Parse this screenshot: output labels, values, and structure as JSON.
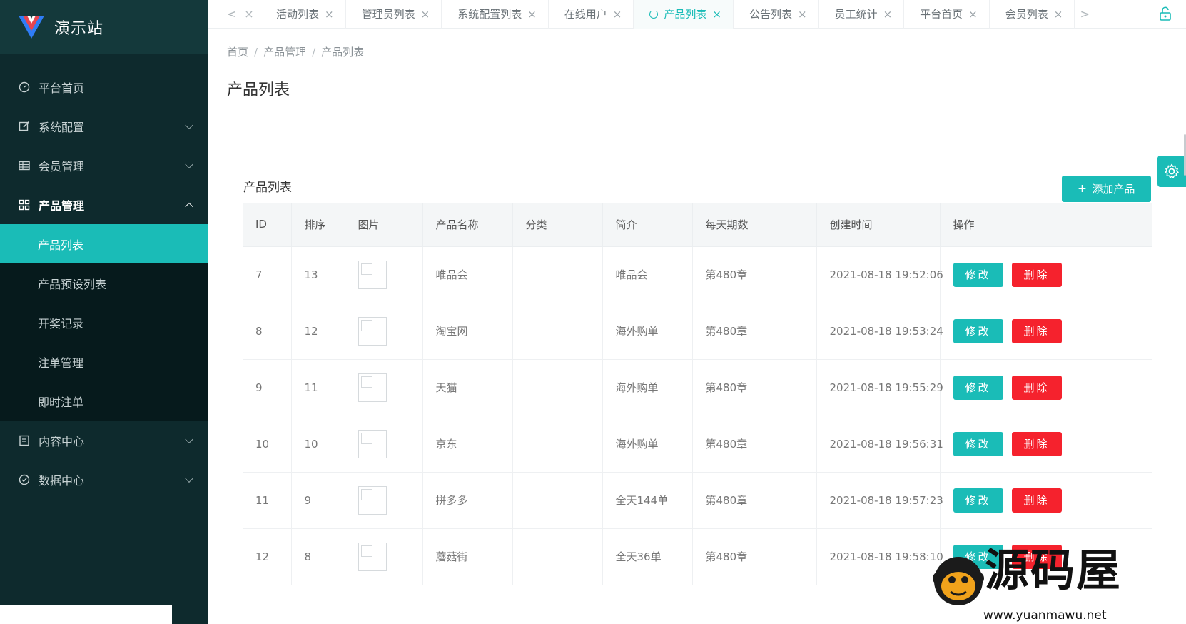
{
  "app": {
    "name": "演示站"
  },
  "sidebar": {
    "items": [
      {
        "label": "平台首页",
        "icon": "dashboard-icon",
        "has_arrow": false
      },
      {
        "label": "系统配置",
        "icon": "edit-icon",
        "has_arrow": true
      },
      {
        "label": "会员管理",
        "icon": "table-icon",
        "has_arrow": true
      },
      {
        "label": "产品管理",
        "icon": "grid-icon",
        "has_arrow": true,
        "open": true
      }
    ],
    "submenu": [
      {
        "label": "产品列表",
        "active": true
      },
      {
        "label": "产品预设列表"
      },
      {
        "label": "开奖记录"
      },
      {
        "label": "注单管理"
      },
      {
        "label": "即时注单"
      }
    ],
    "items_after": [
      {
        "label": "内容中心",
        "icon": "document-icon"
      },
      {
        "label": "数据中心",
        "icon": "check-circle-icon"
      }
    ]
  },
  "tabs": {
    "prev": "<",
    "next": ">",
    "first_close": "×",
    "items": [
      {
        "label": "活动列表"
      },
      {
        "label": "管理员列表"
      },
      {
        "label": "系统配置列表"
      },
      {
        "label": "在线用户"
      },
      {
        "label": "产品列表",
        "active": true
      },
      {
        "label": "公告列表"
      },
      {
        "label": "员工统计"
      },
      {
        "label": "平台首页"
      },
      {
        "label": "会员列表"
      }
    ],
    "close": "×"
  },
  "breadcrumb": {
    "home": "首页",
    "section": "产品管理",
    "current": "产品列表",
    "sep": "/"
  },
  "page": {
    "title": "产品列表"
  },
  "card": {
    "title": "产品列表",
    "add_button": "添加产品",
    "add_plus": "+"
  },
  "table": {
    "columns": [
      "ID",
      "排序",
      "图片",
      "产品名称",
      "分类",
      "简介",
      "每天期数",
      "创建时间",
      "操作"
    ],
    "edit_label": "修改",
    "delete_label": "删除",
    "rows": [
      {
        "id": "7",
        "sort": "13",
        "name": "唯品会",
        "category": "",
        "intro": "唯品会",
        "periods": "第480章",
        "created": "2021-08-18 19:52:06"
      },
      {
        "id": "8",
        "sort": "12",
        "name": "淘宝网",
        "category": "",
        "intro": "海外购单",
        "periods": "第480章",
        "created": "2021-08-18 19:53:24"
      },
      {
        "id": "9",
        "sort": "11",
        "name": "天猫",
        "category": "",
        "intro": "海外购单",
        "periods": "第480章",
        "created": "2021-08-18 19:55:29"
      },
      {
        "id": "10",
        "sort": "10",
        "name": "京东",
        "category": "",
        "intro": "海外购单",
        "periods": "第480章",
        "created": "2021-08-18 19:56:31"
      },
      {
        "id": "11",
        "sort": "9",
        "name": "拼多多",
        "category": "",
        "intro": "全天144单",
        "periods": "第480章",
        "created": "2021-08-18 19:57:23"
      },
      {
        "id": "12",
        "sort": "8",
        "name": "蘑菇街",
        "category": "",
        "intro": "全天36单",
        "periods": "第480章",
        "created": "2021-08-18 19:58:10"
      }
    ]
  },
  "watermark": {
    "text": "源码屋",
    "url": "www.yuanmawu.net"
  },
  "colors": {
    "accent": "#1abcb7",
    "danger": "#f5222d",
    "sidebar": "#0e2a2d"
  }
}
